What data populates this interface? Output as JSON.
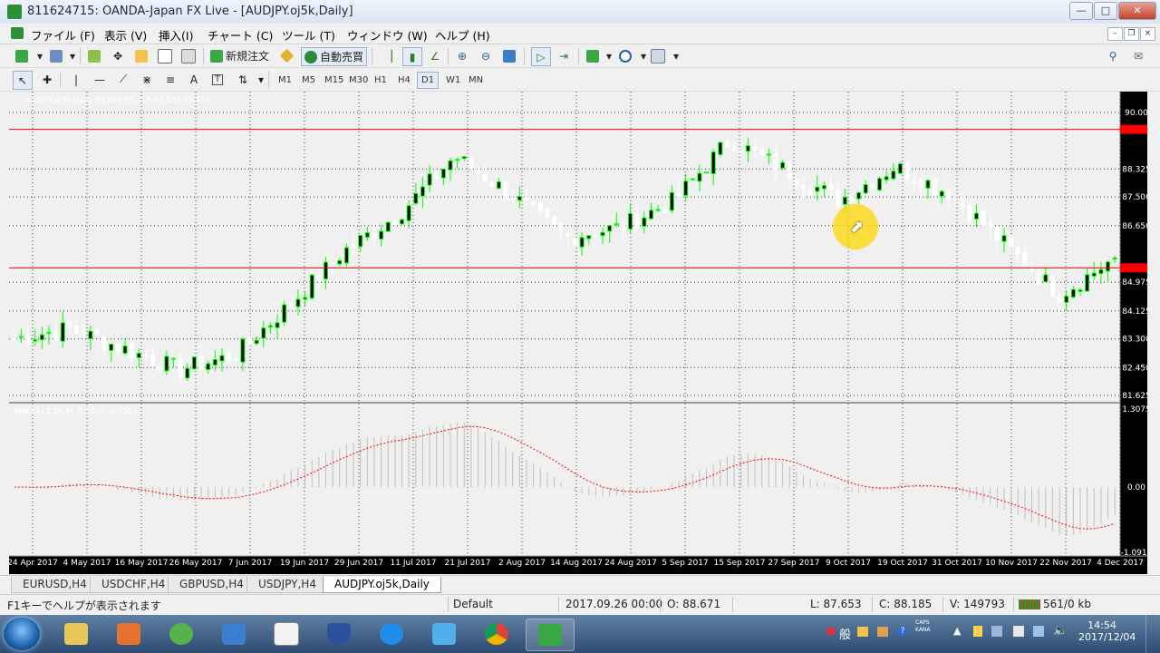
{
  "window": {
    "title": "811624715: OANDA-Japan FX Live - [AUDJPY.oj5k,Daily]"
  },
  "menu": [
    "ファイル (F)",
    "表示 (V)",
    "挿入(I)",
    "チャート (C)",
    "ツール (T)",
    "ウィンドウ (W)",
    "ヘルプ (H)"
  ],
  "toolbar": {
    "new_order_label": "新規注文",
    "auto_trade_label": "自動売買",
    "timeframes": [
      "M1",
      "M5",
      "M15",
      "M30",
      "H1",
      "H4",
      "D1",
      "W1",
      "MN"
    ],
    "active_timeframe": "D1"
  },
  "chart": {
    "info_line": "AUDJPY.oj5k.Daily  85.664 85.758 85.533 85.694",
    "macd_label": "MACD(12,26,9) -0.5928 -0.7565",
    "price_labels": [
      "90.00",
      "88.325",
      "87.500",
      "86.650",
      "84.975",
      "84.125",
      "83.300",
      "82.450",
      "81.625"
    ],
    "macd_labels": [
      "1.3075",
      "0.00",
      "-1.0911"
    ],
    "date_labels": [
      "24 Apr 2017",
      "4 May 2017",
      "16 May 2017",
      "26 May 2017",
      "7 Jun 2017",
      "19 Jun 2017",
      "29 Jun 2017",
      "11 Jul 2017",
      "21 Jul 2017",
      "2 Aug 2017",
      "14 Aug 2017",
      "24 Aug 2017",
      "5 Sep 2017",
      "15 Sep 2017",
      "27 Sep 2017",
      "9 Oct 2017",
      "19 Oct 2017",
      "31 Oct 2017",
      "10 Nov 2017",
      "22 Nov 2017",
      "4 Dec 2017"
    ],
    "colors": {
      "background": "#000000",
      "bull": "#00ff00",
      "bear": "#ffffff",
      "hline": "#ff0000",
      "grid": "#3a3a3a",
      "macd_bars": "#c0c0c0",
      "signal": "#ff0000"
    }
  },
  "chart_data": {
    "type": "candlestick",
    "symbol": "AUDJPY.oj5k",
    "timeframe": "Daily",
    "date_range": [
      "24 Apr 2017",
      "4 Dec 2017"
    ],
    "last_ohlc": {
      "open": 85.664,
      "high": 85.758,
      "low": 85.533,
      "close": 85.694
    },
    "ylim": [
      81.625,
      90.0
    ],
    "horizontal_lines": [
      89.5,
      85.4
    ],
    "close_path": [
      [
        "24 Apr 2017",
        83.3
      ],
      [
        "4 May 2017",
        83.6
      ],
      [
        "16 May 2017",
        83.0
      ],
      [
        "26 May 2017",
        82.4
      ],
      [
        "7 Jun 2017",
        82.8
      ],
      [
        "19 Jun 2017",
        84.3
      ],
      [
        "29 Jun 2017",
        85.9
      ],
      [
        "11 Jul 2017",
        87.0
      ],
      [
        "21 Jul 2017",
        88.7
      ],
      [
        "2 Aug 2017",
        87.6
      ],
      [
        "14 Aug 2017",
        86.3
      ],
      [
        "24 Aug 2017",
        86.6
      ],
      [
        "5 Sep 2017",
        87.4
      ],
      [
        "15 Sep 2017",
        89.2
      ],
      [
        "27 Sep 2017",
        88.3
      ],
      [
        "9 Oct 2017",
        87.4
      ],
      [
        "19 Oct 2017",
        88.4
      ],
      [
        "31 Oct 2017",
        87.6
      ],
      [
        "10 Nov 2017",
        86.1
      ],
      [
        "22 Nov 2017",
        84.6
      ],
      [
        "4 Dec 2017",
        85.69
      ]
    ],
    "macd": {
      "label": "MACD(12,26,9)",
      "main": -0.5928,
      "signal": -0.7565,
      "ylim": [
        -1.0911,
        1.3075
      ]
    }
  },
  "tabs": [
    "EURUSD,H4",
    "USDCHF,H4",
    "GBPUSD,H4",
    "USDJPY,H4",
    "AUDJPY.oj5k,Daily"
  ],
  "active_tab": "AUDJPY.oj5k,Daily",
  "status": {
    "help": "F1キーでヘルプが表示されます",
    "profile": "Default",
    "datetime": "2017.09.26 00:00",
    "open": "O: 88.671",
    "low": "L: 87.653",
    "close": "C: 88.185",
    "volume": "V: 149793",
    "traffic": "561/0 kb"
  },
  "taskbar": {
    "time": "14:54",
    "date": "2017/12/04"
  }
}
